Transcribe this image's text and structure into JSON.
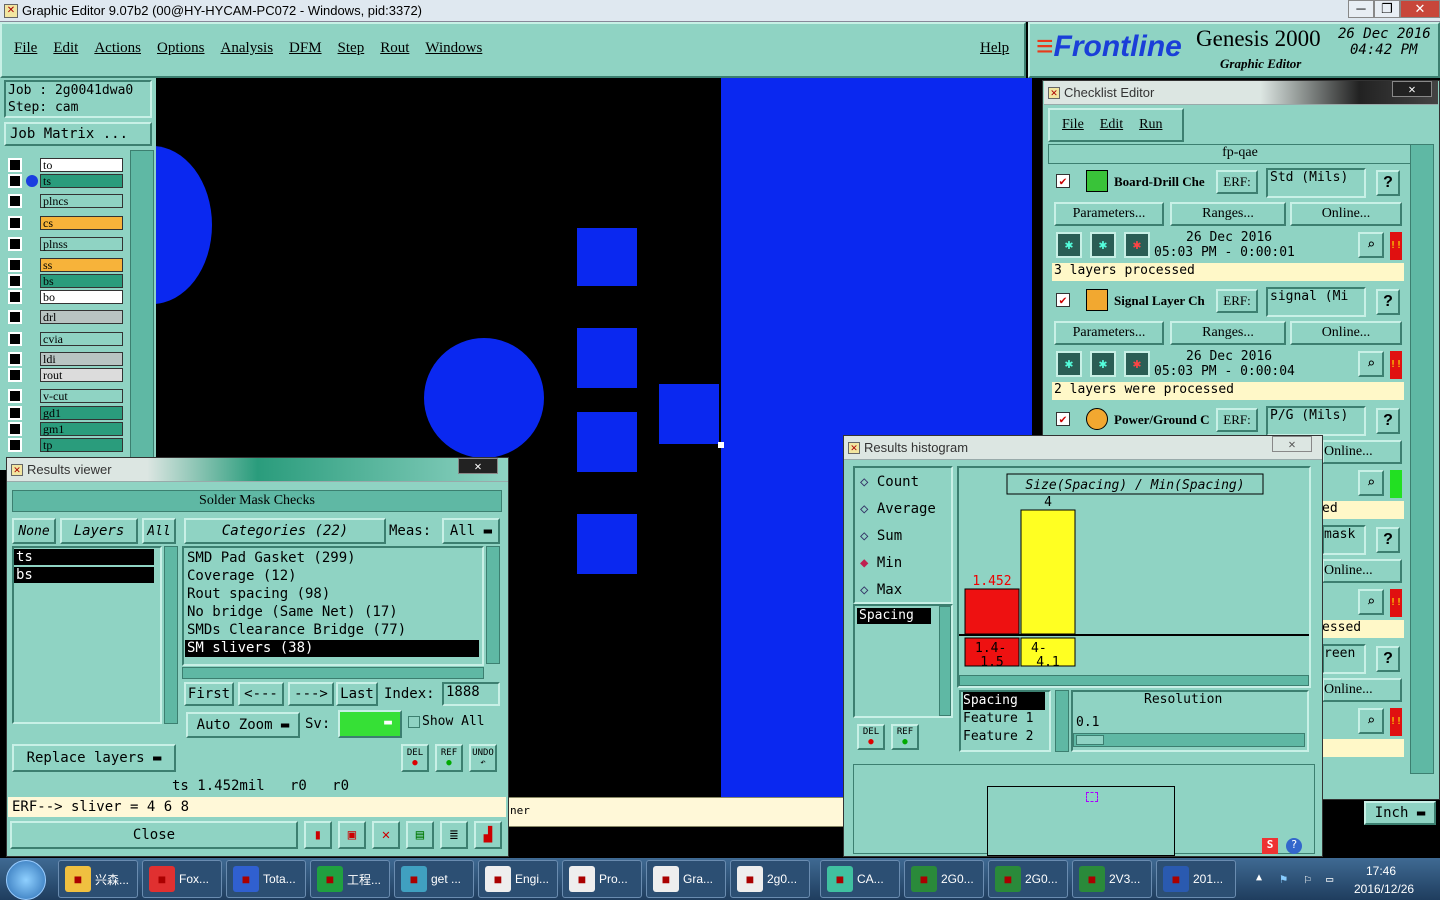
{
  "window": {
    "title": "Graphic Editor 9.07b2 (00@HY-HYCAM-PC072 - Windows, pid:3372)"
  },
  "menu": {
    "items": [
      "File",
      "Edit",
      "Actions",
      "Options",
      "Analysis",
      "DFM",
      "Step",
      "Rout",
      "Windows"
    ],
    "help": "Help"
  },
  "brand": {
    "logo": "Frontline",
    "product": "Genesis 2000",
    "subtitle": "Graphic Editor",
    "date": "26 Dec 2016",
    "time": "04:42 PM"
  },
  "job": {
    "job_label": "Job : 2g0041dwa0",
    "step_label": "Step: cam",
    "matrix_button": "Job Matrix ..."
  },
  "layers": [
    {
      "name": "to",
      "color": "#ffffff"
    },
    {
      "name": "ts",
      "color": "#2a9c7c"
    },
    {
      "name": "plncs",
      "color": "#8fd3c3"
    },
    {
      "name": "cs",
      "color": "#f7b33a"
    },
    {
      "name": "plnss",
      "color": "#8fd3c3"
    },
    {
      "name": "ss",
      "color": "#f7b33a"
    },
    {
      "name": "bs",
      "color": "#2a9c7c"
    },
    {
      "name": "bo",
      "color": "#ffffff"
    },
    {
      "name": "drl",
      "color": "#b8c4c2"
    },
    {
      "name": "cvia",
      "color": "#8fd3c3"
    },
    {
      "name": "ldi",
      "color": "#b8c4c2"
    },
    {
      "name": "rout",
      "color": "#dcdcdc"
    },
    {
      "name": "v-cut",
      "color": "#8fd3c3"
    },
    {
      "name": "gd1",
      "color": "#2a9c7c"
    },
    {
      "name": "gm1",
      "color": "#2a9c7c"
    },
    {
      "name": "tp",
      "color": "#2a9c7c"
    }
  ],
  "checklist": {
    "title": "Checklist Editor",
    "menu": [
      "File",
      "Edit",
      "Run"
    ],
    "name": "fp-qae",
    "checks": [
      {
        "name": "Board-Drill Che",
        "erf": "ERF:",
        "erf_value": "Std (Mils)",
        "params": "Parameters...",
        "ranges": "Ranges...",
        "online": "Online...",
        "date": "26 Dec 2016",
        "time": "05:03 PM - 0:00:01",
        "status": "3 layers processed"
      },
      {
        "name": "Signal Layer Ch",
        "erf": "ERF:",
        "erf_value": "signal (Mi",
        "params": "Parameters...",
        "ranges": "Ranges...",
        "online": "Online...",
        "date": "26 Dec 2016",
        "time": "05:03 PM - 0:00:04",
        "status": "2 layers were processed"
      },
      {
        "name": "Power/Ground C",
        "erf": "ERF:",
        "erf_value": "P/G (Mils)",
        "params": "Parameters...",
        "ranges": "Ranges...",
        "online": "Online..."
      }
    ],
    "partial": {
      "online1": "Online...",
      "status1": "ed",
      "erf1": "mask",
      "online2": "Online...",
      "status2": "essed",
      "erf2": "reen",
      "online3": "Online..."
    },
    "help": "?"
  },
  "histogram": {
    "title": "Results histogram",
    "options": [
      "Count",
      "Average",
      "Sum",
      "Min",
      "Max"
    ],
    "selected": "Min",
    "list_item": "Spacing",
    "chart_title": "Size(Spacing) / Min(Spacing)",
    "del": "DEL",
    "ref": "REF",
    "table": [
      "Spacing",
      "Feature 1",
      "Feature 2"
    ],
    "resolution_label": "Resolution",
    "resolution_value": "0.1"
  },
  "chart_data": {
    "type": "bar",
    "title": "Size(Spacing) / Min(Spacing)",
    "categories": [
      "1.4-1.5",
      "4-4.1"
    ],
    "values": [
      1.452,
      4
    ],
    "value_labels": [
      "1.452",
      "4"
    ],
    "colors": [
      "#ee1111",
      "#ffff22"
    ],
    "cat_labels": [
      [
        "1.4-",
        "1.5"
      ],
      [
        "4-",
        "4.1"
      ]
    ]
  },
  "results": {
    "title": "Results viewer",
    "header": "Solder Mask Checks",
    "none": "None",
    "layers": "Layers",
    "all": "All",
    "categories": "Categories (22)",
    "meas_label": "Meas:",
    "meas_value": "All",
    "layer_list": [
      "ts",
      "bs"
    ],
    "category_list": [
      "SMD Pad Gasket (299)",
      "Coverage (12)",
      "Rout spacing (98)",
      "No bridge (Same Net) (17)",
      "SMDs Clearance Bridge (77)",
      "SM slivers (38)"
    ],
    "first": "First",
    "prev": "<---",
    "next": "--->",
    "last": "Last",
    "index_label": "Index:",
    "index_value": "1888",
    "autozoom": "Auto Zoom",
    "sv": "Sv:",
    "show_all": "Show All",
    "replace": "Replace layers",
    "del": "DEL",
    "ref": "REF",
    "undo": "UNDO",
    "info": "ts 1.452mil   r0   r0",
    "erf_line": "ERF--> sliver = 4 6 8",
    "close": "Close"
  },
  "status_strip": {
    "text": "ner",
    "units": "Inch"
  },
  "taskbar": {
    "items": [
      "兴森...",
      "Fox...",
      "Tota...",
      "工程...",
      "get ...",
      "Engi...",
      "Pro...",
      "Gra...",
      "2g0...",
      "CA...",
      "2G0...",
      "2G0...",
      "2V3...",
      "201..."
    ],
    "clock_time": "17:46",
    "clock_date": "2016/12/26"
  }
}
